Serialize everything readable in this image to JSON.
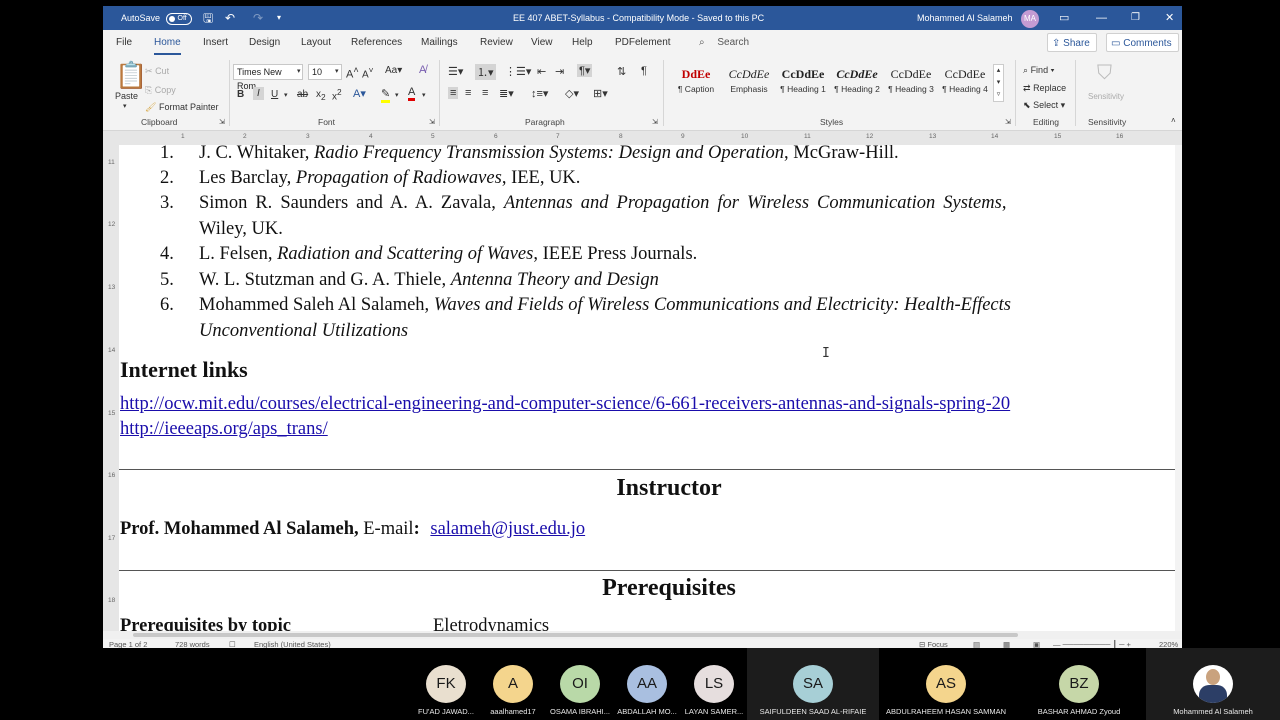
{
  "titlebar": {
    "autosave": "AutoSave",
    "autosave_state": "Off",
    "doc_title": "EE 407 ABET-Syllabus - Compatibility Mode - Saved to this PC",
    "user": "Mohammed Al Salameh",
    "user_initials": "MA"
  },
  "menu": {
    "tabs": [
      "File",
      "Home",
      "Insert",
      "Design",
      "Layout",
      "References",
      "Mailings",
      "Review",
      "View",
      "Help",
      "PDFelement"
    ],
    "active": "Home",
    "search": "Search",
    "share": "Share",
    "comments": "Comments"
  },
  "ribbon": {
    "clipboard": {
      "paste": "Paste",
      "cut": "Cut",
      "copy": "Copy",
      "format_painter": "Format Painter",
      "label": "Clipboard"
    },
    "font": {
      "name": "Times New Rom",
      "size": "10",
      "label": "Font"
    },
    "paragraph": {
      "label": "Paragraph"
    },
    "styles": {
      "label": "Styles",
      "items": [
        {
          "preview": "DdEe",
          "name": "¶ Caption"
        },
        {
          "preview": "CcDdEe",
          "name": "Emphasis"
        },
        {
          "preview": "CcDdEe",
          "name": "¶ Heading 1"
        },
        {
          "preview": "CcDdEe",
          "name": "¶ Heading 2"
        },
        {
          "preview": "CcDdEe",
          "name": "¶ Heading 3"
        },
        {
          "preview": "CcDdEe",
          "name": "¶ Heading 4"
        }
      ]
    },
    "editing": {
      "find": "Find",
      "replace": "Replace",
      "select": "Select",
      "label": "Editing"
    },
    "sensitivity": {
      "button": "Sensitivity",
      "label": "Sensitivity"
    }
  },
  "document": {
    "references": [
      {
        "num": "1.",
        "author": "J. C. Whitaker, ",
        "title": "Radio Frequency Transmission Systems: Design and Operation",
        "rest": ", McGraw-Hill."
      },
      {
        "num": "2.",
        "author": "Les Barclay, ",
        "title": "Propagation of Radiowaves",
        "rest": ", IEE, UK."
      },
      {
        "num": "3.",
        "author": "Simon R. Saunders and A. A. Zavala, ",
        "title": "Antennas and Propagation for Wireless Communication Systems",
        "rest": ",",
        "cont": "Wiley, UK."
      },
      {
        "num": "4.",
        "author": "L. Felsen, ",
        "title": "Radiation and Scattering of Waves",
        "rest": ", IEEE Press Journals."
      },
      {
        "num": "5.",
        "author": "W. L. Stutzman and G. A. Thiele, ",
        "title": "Antenna Theory and Design",
        "rest": ""
      },
      {
        "num": "6.",
        "author": "Mohammed Saleh Al Salameh, ",
        "title": "Waves and Fields of Wireless Communications and Electricity: Health-Effects",
        "rest": "",
        "cont_italic": "Unconventional Utilizations"
      }
    ],
    "internet_links_heading": "Internet links",
    "links": [
      "http://ocw.mit.edu/courses/electrical-engineering-and-computer-science/6-661-receivers-antennas-and-signals-spring-20",
      "http://ieeeaps.org/aps_trans/"
    ],
    "instructor_heading": "Instructor",
    "instructor_name": "Prof. Mohammed Al Salameh,",
    "email_label": " E-mail",
    "email_colon": ":",
    "email": "salameh@just.edu.jo",
    "prereq_heading": "Prerequisites",
    "prereq_by_topic": "Prerequisites by topic",
    "prereq_value": "Eletrodynamics"
  },
  "statusbar": {
    "page": "Page 1 of 2",
    "words": "728 words",
    "language": "English (United States)",
    "focus": "Focus",
    "zoom": "220%"
  },
  "participants": [
    {
      "initials": "FK",
      "name": "FU'AD JAWAD...",
      "color": "#e9dfcf"
    },
    {
      "initials": "A",
      "name": "aaalhamed17",
      "color": "#f4d58d"
    },
    {
      "initials": "OI",
      "name": "OSAMA IBRAHI...",
      "color": "#b9d9a8"
    },
    {
      "initials": "AA",
      "name": "ABDALLAH MO...",
      "color": "#a9bfe0"
    },
    {
      "initials": "LS",
      "name": "LAYAN SAMER...",
      "color": "#e6dede"
    },
    {
      "initials": "SA",
      "name": "SAIFULDEEN SAAD AL-RIFAIE",
      "color": "#a7cfd6"
    },
    {
      "initials": "AS",
      "name": "ABDULRAHEEM HASAN SAMMAN",
      "color": "#f4d58d"
    },
    {
      "initials": "BZ",
      "name": "BASHAR AHMAD Zyoud",
      "color": "#c6d7a8"
    },
    {
      "initials": "",
      "name": "Mohammed Al Salameh",
      "color": "#ffffff"
    }
  ]
}
